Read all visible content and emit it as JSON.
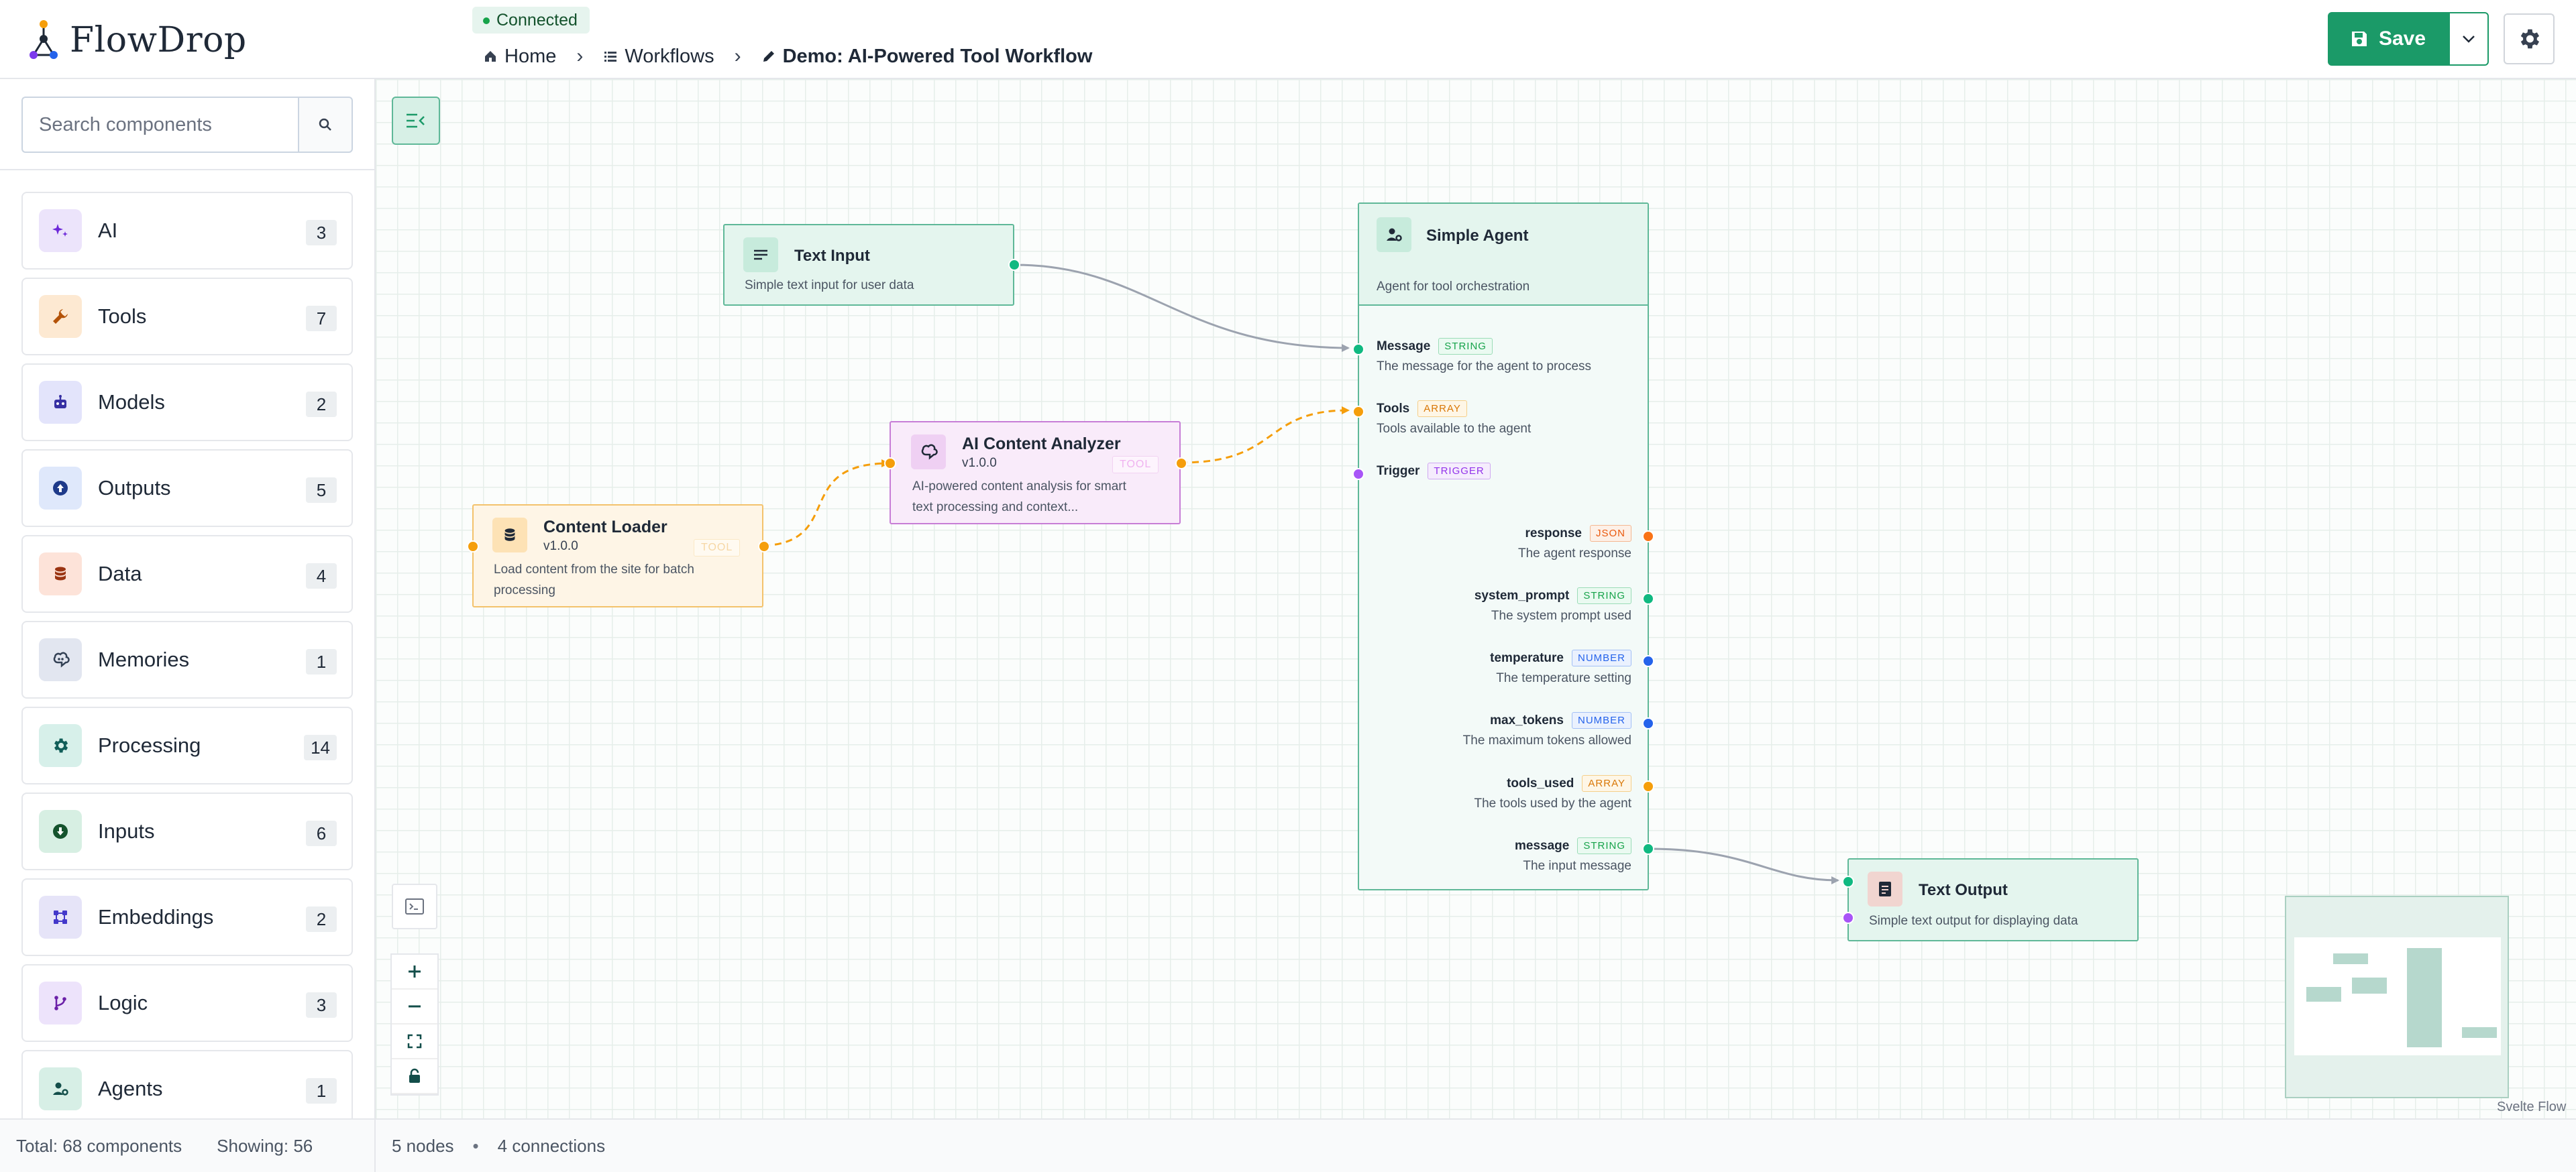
{
  "app": {
    "name": "FlowDrop",
    "connection_status": "Connected",
    "breadcrumbs": [
      "Home",
      "Workflows",
      "Demo: AI-Powered Tool Workflow"
    ],
    "save_label": "Save",
    "accent_color": "#1b9a68"
  },
  "sidebar": {
    "search_placeholder": "Search components",
    "categories": [
      {
        "label": "AI",
        "count": "3",
        "icon": "sparkles-icon"
      },
      {
        "label": "Tools",
        "count": "7",
        "icon": "wrench-icon"
      },
      {
        "label": "Models",
        "count": "2",
        "icon": "robot-icon"
      },
      {
        "label": "Outputs",
        "count": "5",
        "icon": "upload-icon"
      },
      {
        "label": "Data",
        "count": "4",
        "icon": "database-icon"
      },
      {
        "label": "Memories",
        "count": "1",
        "icon": "brain-icon"
      },
      {
        "label": "Processing",
        "count": "14",
        "icon": "gear-icon"
      },
      {
        "label": "Inputs",
        "count": "6",
        "icon": "download-icon"
      },
      {
        "label": "Embeddings",
        "count": "2",
        "icon": "graph-icon"
      },
      {
        "label": "Logic",
        "count": "3",
        "icon": "branch-icon"
      },
      {
        "label": "Agents",
        "count": "1",
        "icon": "user-gear-icon"
      }
    ],
    "total": "Total: 68 components",
    "showing": "Showing: 56"
  },
  "status": {
    "nodes": "5 nodes",
    "separator": "•",
    "connections": "4 connections"
  },
  "nodes": {
    "text_input": {
      "title": "Text Input",
      "desc": "Simple text input for user data"
    },
    "ai_analyzer": {
      "title": "AI Content Analyzer",
      "version": "v1.0.0",
      "tag": "TOOL",
      "desc_1": "AI-powered content analysis for smart",
      "desc_2": "text processing and context..."
    },
    "content_loader": {
      "title": "Content Loader",
      "version": "v1.0.0",
      "tag": "TOOL",
      "desc_1": "Load content from the site for batch",
      "desc_2": "processing"
    },
    "simple_agent": {
      "title": "Simple Agent",
      "desc": "Agent for tool orchestration",
      "inputs": [
        {
          "name": "Message",
          "type": "STRING",
          "desc": "The message for the agent to process"
        },
        {
          "name": "Tools",
          "type": "ARRAY",
          "desc": "Tools available to the agent"
        },
        {
          "name": "Trigger",
          "type": "TRIGGER",
          "desc": ""
        }
      ],
      "outputs": [
        {
          "name": "response",
          "type": "JSON",
          "desc": "The agent response"
        },
        {
          "name": "system_prompt",
          "type": "STRING",
          "desc": "The system prompt used"
        },
        {
          "name": "temperature",
          "type": "NUMBER",
          "desc": "The temperature setting"
        },
        {
          "name": "max_tokens",
          "type": "NUMBER",
          "desc": "The maximum tokens allowed"
        },
        {
          "name": "tools_used",
          "type": "ARRAY",
          "desc": "The tools used by the agent"
        },
        {
          "name": "message",
          "type": "STRING",
          "desc": "The input message"
        }
      ]
    },
    "text_output": {
      "title": "Text Output",
      "desc": "Simple text output for displaying data"
    }
  },
  "attribution": "Svelte Flow"
}
